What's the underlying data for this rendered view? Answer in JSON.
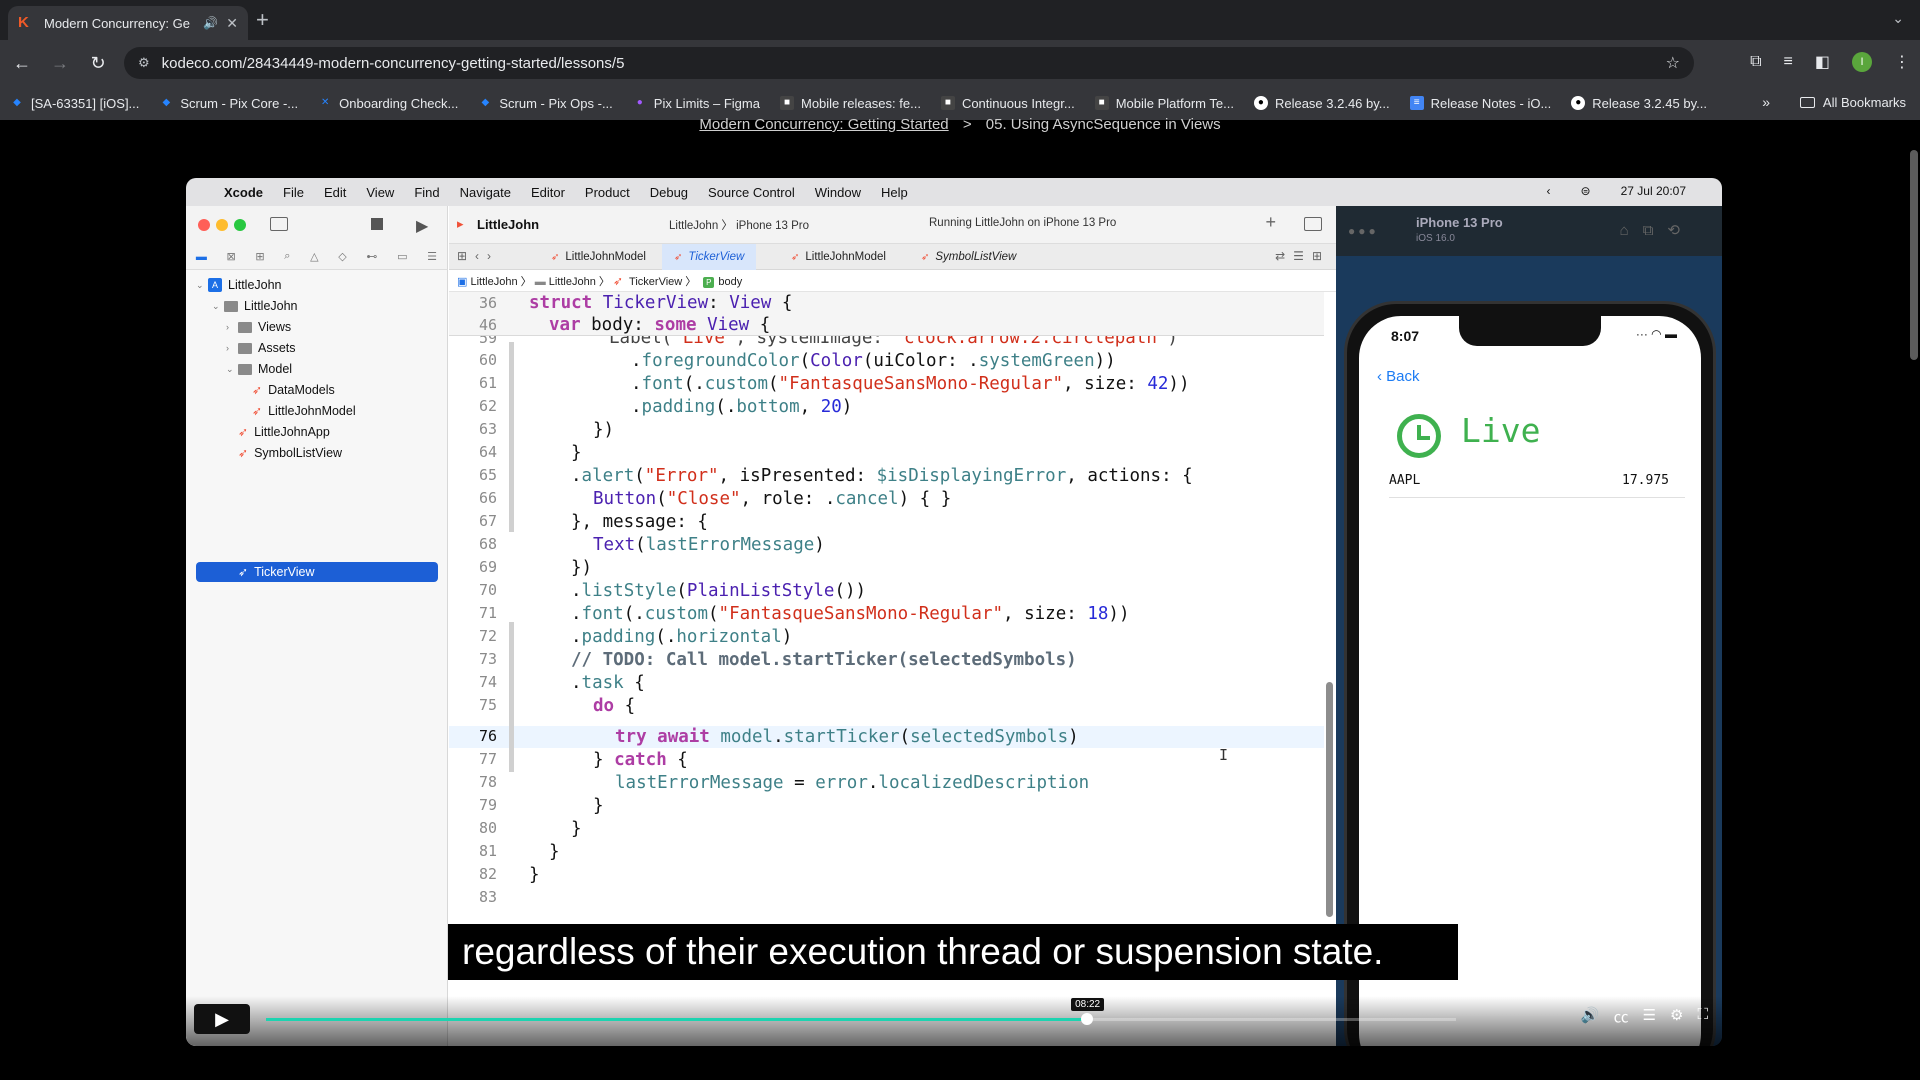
{
  "browser": {
    "tab_title": "Modern Concurrency: Ge",
    "url": "kodeco.com/28434449-modern-concurrency-getting-started/lessons/5",
    "bookmarks": [
      {
        "label": "[SA-63351] [iOS]...",
        "color": "#2684ff"
      },
      {
        "label": "Scrum - Pix Core -...",
        "color": "#2684ff"
      },
      {
        "label": "Onboarding Check...",
        "color": "#2684ff"
      },
      {
        "label": "Scrum - Pix Ops -...",
        "color": "#2684ff"
      },
      {
        "label": "Pix Limits – Figma",
        "color": "#a259ff"
      },
      {
        "label": "Mobile releases: fe...",
        "color": "#444444"
      },
      {
        "label": "Continuous Integr...",
        "color": "#444444"
      },
      {
        "label": "Mobile Platform Te...",
        "color": "#444444"
      },
      {
        "label": "Release 3.2.46 by...",
        "color": "#ffffff"
      },
      {
        "label": "Release Notes - iO...",
        "color": "#4285f4"
      },
      {
        "label": "Release 3.2.45 by...",
        "color": "#ffffff"
      }
    ],
    "all_bookmarks": "All Bookmarks",
    "profile_initial": "I"
  },
  "page": {
    "course_link": "Modern Concurrency: Getting Started",
    "separator": ">",
    "lesson": "05. Using AsyncSequence in Views"
  },
  "mac": {
    "menus": [
      "Xcode",
      "File",
      "Edit",
      "View",
      "Find",
      "Navigate",
      "Editor",
      "Product",
      "Debug",
      "Source Control",
      "Window",
      "Help"
    ],
    "datetime": "27 Jul  20:07"
  },
  "xcode": {
    "title": "LittleJohn",
    "scheme": "LittleJohn  〉  iPhone 13 Pro",
    "status": "Running LittleJohn on iPhone 13 Pro",
    "tabs": [
      "LittleJohnModel",
      "TickerView",
      "LittleJohnModel",
      "SymbolListView"
    ],
    "jumpbar": [
      "LittleJohn",
      "LittleJohn",
      "TickerView",
      "body"
    ],
    "navigator": [
      {
        "label": "LittleJohn",
        "kind": "project"
      },
      {
        "label": "LittleJohn",
        "kind": "folder"
      },
      {
        "label": "Views",
        "kind": "folder"
      },
      {
        "label": "Assets",
        "kind": "folder"
      },
      {
        "label": "Model",
        "kind": "folder"
      },
      {
        "label": "DataModels",
        "kind": "swift"
      },
      {
        "label": "LittleJohnModel",
        "kind": "swift"
      },
      {
        "label": "LittleJohnApp",
        "kind": "swift"
      },
      {
        "label": "SymbolListView",
        "kind": "swift"
      },
      {
        "label": "TickerView",
        "kind": "swift"
      }
    ],
    "sticky_lines": [
      "36",
      "46"
    ],
    "line_numbers": [
      "59",
      "60",
      "61",
      "62",
      "63",
      "64",
      "65",
      "66",
      "67",
      "68",
      "69",
      "70",
      "71",
      "72",
      "73",
      "74",
      "75",
      "76",
      "77",
      "78",
      "79",
      "80",
      "81",
      "82",
      "83"
    ],
    "current_line": "76"
  },
  "simulator": {
    "device": "iPhone 13 Pro",
    "os": "iOS 16.0",
    "time": "8:07",
    "back": "Back",
    "live": "Live",
    "rows": [
      {
        "symbol": "AAPL",
        "price": "17.975"
      }
    ]
  },
  "player": {
    "caption": "regardless of their execution thread or suspension state.",
    "timestamp": "08:22",
    "progress": 0.69
  }
}
